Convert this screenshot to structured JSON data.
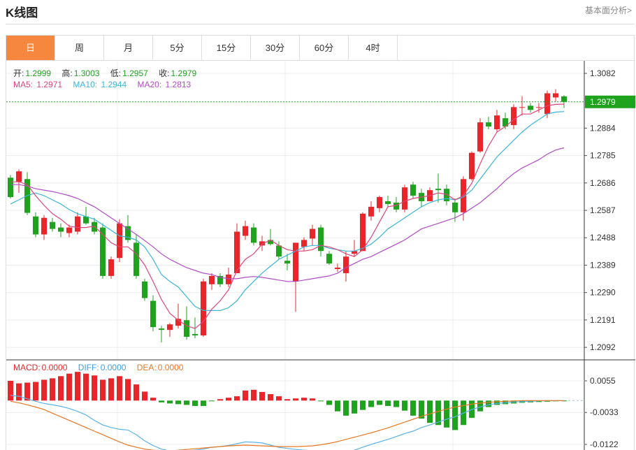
{
  "header": {
    "title": "K线图",
    "more_link": "基本面分析>"
  },
  "tabs": [
    {
      "label": "日",
      "active": true
    },
    {
      "label": "周"
    },
    {
      "label": "月"
    },
    {
      "label": "5分"
    },
    {
      "label": "15分"
    },
    {
      "label": "30分"
    },
    {
      "label": "60分"
    },
    {
      "label": "4时"
    }
  ],
  "ohlc_legend": {
    "open_label": "开:",
    "open": "1.2999",
    "high_label": "高:",
    "high": "1.3003",
    "low_label": "低:",
    "low": "1.2957",
    "close_label": "收:",
    "close": "1.2979"
  },
  "ma_legend": {
    "ma5_label": "MA5:",
    "ma5": "1.2971",
    "ma10_label": "MA10:",
    "ma10": "1.2944",
    "ma20_label": "MA20:",
    "ma20": "1.2813"
  },
  "macd_legend": {
    "macd_label": "MACD:",
    "macd": "0.0000",
    "diff_label": "DIFF:",
    "diff": "0.0000",
    "dea_label": "DEA:",
    "dea": "0.0000"
  },
  "price_axis_ticks": [
    "1.3082",
    "1.2884",
    "1.2785",
    "1.2686",
    "1.2587",
    "1.2488",
    "1.2389",
    "1.2290",
    "1.2191",
    "1.2092"
  ],
  "current_price_label": "1.2979",
  "macd_axis_ticks": [
    "0.0055",
    "-0.0033",
    "-0.0122"
  ],
  "colors": {
    "up": "#e8262a",
    "down": "#1fa31f",
    "ma5": "#e0457b",
    "ma10": "#38b6d8",
    "ma20": "#b04cc4",
    "dea": "#e87722",
    "diff": "#5bb2e8",
    "accent": "#f5873f"
  },
  "chart_data": {
    "type": "candlestick",
    "yrange": [
      1.2072,
      1.3082
    ],
    "candles": [
      [
        1.2705,
        1.2715,
        1.263,
        1.2635
      ],
      [
        1.269,
        1.2735,
        1.265,
        1.2728
      ],
      [
        1.27,
        1.2725,
        1.257,
        1.2578
      ],
      [
        1.2565,
        1.258,
        1.249,
        1.25
      ],
      [
        1.25,
        1.257,
        1.248,
        1.256
      ],
      [
        1.2545,
        1.256,
        1.251,
        1.252
      ],
      [
        1.2525,
        1.254,
        1.249,
        1.251
      ],
      [
        1.2505,
        1.2535,
        1.249,
        1.2525
      ],
      [
        1.251,
        1.258,
        1.25,
        1.2565
      ],
      [
        1.2565,
        1.26,
        1.2535,
        1.254
      ],
      [
        1.2545,
        1.256,
        1.25,
        1.251
      ],
      [
        1.2525,
        1.254,
        1.234,
        1.235
      ],
      [
        1.235,
        1.242,
        1.234,
        1.241
      ],
      [
        1.2415,
        1.2555,
        1.24,
        1.254
      ],
      [
        1.253,
        1.257,
        1.247,
        1.248
      ],
      [
        1.247,
        1.25,
        1.234,
        1.235
      ],
      [
        1.233,
        1.234,
        1.226,
        1.227
      ],
      [
        1.226,
        1.228,
        1.215,
        1.2165
      ],
      [
        1.216,
        1.217,
        1.211,
        1.2155
      ],
      [
        1.2155,
        1.218,
        1.213,
        1.2175
      ],
      [
        1.217,
        1.225,
        1.216,
        1.2195
      ],
      [
        1.219,
        1.224,
        1.212,
        1.213
      ],
      [
        1.214,
        1.22,
        1.2125,
        1.2135
      ],
      [
        1.2135,
        1.234,
        1.213,
        1.233
      ],
      [
        1.232,
        1.236,
        1.23,
        1.235
      ],
      [
        1.235,
        1.236,
        1.231,
        1.232
      ],
      [
        1.232,
        1.238,
        1.231,
        1.2355
      ],
      [
        1.236,
        1.254,
        1.236,
        1.251
      ],
      [
        1.2495,
        1.255,
        1.248,
        1.253
      ],
      [
        1.2525,
        1.254,
        1.246,
        1.247
      ],
      [
        1.246,
        1.2495,
        1.244,
        1.2475
      ],
      [
        1.248,
        1.252,
        1.246,
        1.2465
      ],
      [
        1.246,
        1.2475,
        1.241,
        1.242
      ],
      [
        1.2405,
        1.243,
        1.237,
        1.2395
      ],
      [
        1.233,
        1.247,
        1.222,
        1.247
      ],
      [
        1.2455,
        1.249,
        1.244,
        1.248
      ],
      [
        1.2485,
        1.2535,
        1.246,
        1.252
      ],
      [
        1.2525,
        1.2535,
        1.242,
        1.244
      ],
      [
        1.243,
        1.244,
        1.239,
        1.2395
      ],
      [
        1.2375,
        1.2395,
        1.2365,
        1.238
      ],
      [
        1.236,
        1.244,
        1.233,
        1.242
      ],
      [
        1.243,
        1.248,
        1.242,
        1.244
      ],
      [
        1.244,
        1.258,
        1.244,
        1.2575
      ],
      [
        1.2565,
        1.262,
        1.255,
        1.26
      ],
      [
        1.2595,
        1.264,
        1.258,
        1.2635
      ],
      [
        1.262,
        1.264,
        1.26,
        1.261
      ],
      [
        1.2615,
        1.2635,
        1.258,
        1.259
      ],
      [
        1.259,
        1.268,
        1.258,
        1.267
      ],
      [
        1.268,
        1.269,
        1.263,
        1.264
      ],
      [
        1.265,
        1.2665,
        1.26,
        1.262
      ],
      [
        1.262,
        1.267,
        1.262,
        1.266
      ],
      [
        1.2665,
        1.272,
        1.2615,
        1.266
      ],
      [
        1.2665,
        1.268,
        1.2605,
        1.262
      ],
      [
        1.2615,
        1.263,
        1.2545,
        1.258
      ],
      [
        1.258,
        1.271,
        1.255,
        1.27
      ],
      [
        1.27,
        1.28,
        1.2695,
        1.2795
      ],
      [
        1.28,
        1.292,
        1.2795,
        1.2905
      ],
      [
        1.2905,
        1.2925,
        1.288,
        1.289
      ],
      [
        1.288,
        1.295,
        1.287,
        1.293
      ],
      [
        1.292,
        1.294,
        1.288,
        1.289
      ],
      [
        1.2895,
        1.297,
        1.288,
        1.296
      ],
      [
        1.296,
        1.3,
        1.293,
        1.296
      ],
      [
        1.2965,
        1.2975,
        1.294,
        1.295
      ],
      [
        1.296,
        1.2975,
        1.294,
        1.296
      ],
      [
        1.2935,
        1.302,
        1.292,
        1.301
      ],
      [
        1.2995,
        1.3025,
        1.298,
        1.301
      ],
      [
        1.2999,
        1.3003,
        1.2957,
        1.2979
      ]
    ],
    "ma5": [
      1.269,
      1.269,
      1.268,
      1.264,
      1.2605,
      1.2575,
      1.2555,
      1.253,
      1.2525,
      1.2525,
      1.253,
      1.25,
      1.247,
      1.2455,
      1.2455,
      1.243,
      1.239,
      1.233,
      1.2265,
      1.2215,
      1.219,
      1.217,
      1.216,
      1.2185,
      1.223,
      1.226,
      1.23,
      1.237,
      1.241,
      1.243,
      1.2465,
      1.248,
      1.246,
      1.2445,
      1.244,
      1.244,
      1.2445,
      1.246,
      1.2455,
      1.2445,
      1.243,
      1.242,
      1.2445,
      1.249,
      1.2545,
      1.26,
      1.2605,
      1.262,
      1.263,
      1.2635,
      1.264,
      1.265,
      1.2645,
      1.2625,
      1.264,
      1.2685,
      1.2755,
      1.282,
      1.287,
      1.289,
      1.2915,
      1.2935,
      1.2935,
      1.295,
      1.2965,
      1.297,
      1.2971
    ],
    "ma10": [
      1.261,
      1.2625,
      1.264,
      1.265,
      1.264,
      1.2625,
      1.261,
      1.259,
      1.2575,
      1.2565,
      1.2555,
      1.2535,
      1.2515,
      1.2495,
      1.249,
      1.248,
      1.2455,
      1.241,
      1.2355,
      1.233,
      1.231,
      1.2275,
      1.224,
      1.2225,
      1.2225,
      1.2225,
      1.2235,
      1.226,
      1.23,
      1.233,
      1.236,
      1.2385,
      1.241,
      1.2425,
      1.244,
      1.2455,
      1.246,
      1.246,
      1.245,
      1.2445,
      1.244,
      1.244,
      1.245,
      1.2465,
      1.249,
      1.252,
      1.254,
      1.256,
      1.258,
      1.26,
      1.2615,
      1.2625,
      1.263,
      1.2625,
      1.2635,
      1.266,
      1.27,
      1.274,
      1.278,
      1.281,
      1.284,
      1.287,
      1.2895,
      1.2915,
      1.2935,
      1.2942,
      1.2944
    ],
    "ma20": [
      1.268,
      1.268,
      1.2675,
      1.2665,
      1.266,
      1.2655,
      1.2648,
      1.264,
      1.263,
      1.2615,
      1.26,
      1.258,
      1.256,
      1.254,
      1.252,
      1.25,
      1.2478,
      1.2455,
      1.243,
      1.241,
      1.2395,
      1.238,
      1.237,
      1.236,
      1.2355,
      1.2345,
      1.234,
      1.234,
      1.2345,
      1.2348,
      1.2345,
      1.234,
      1.2335,
      1.233,
      1.233,
      1.2335,
      1.234,
      1.2345,
      1.235,
      1.236,
      1.238,
      1.2395,
      1.241,
      1.242,
      1.2435,
      1.245,
      1.2465,
      1.248,
      1.25,
      1.252,
      1.253,
      1.254,
      1.255,
      1.256,
      1.2575,
      1.2595,
      1.2615,
      1.264,
      1.2665,
      1.2695,
      1.272,
      1.274,
      1.2755,
      1.277,
      1.279,
      1.2805,
      1.2813
    ],
    "macd": {
      "yrange": [
        -0.0122,
        0.009
      ],
      "hist": [
        0.0055,
        0.0048,
        0.005,
        0.0052,
        0.0058,
        0.0062,
        0.0068,
        0.0075,
        0.008,
        0.0075,
        0.007,
        0.0058,
        0.0062,
        0.0068,
        0.006,
        0.0045,
        0.0025,
        0.0008,
        -0.0005,
        -0.0008,
        -0.001,
        -0.0012,
        -0.0015,
        -0.0015,
        -0.0002,
        0.0004,
        0.0008,
        0.0012,
        0.0028,
        0.003,
        0.0024,
        0.0018,
        0.0012,
        0.0004,
        0.0006,
        0.0008,
        0.0006,
        -0.0002,
        -0.0012,
        -0.003,
        -0.0042,
        -0.0036,
        -0.0026,
        -0.0018,
        -0.0012,
        -0.0015,
        -0.0018,
        -0.0028,
        -0.0042,
        -0.005,
        -0.0062,
        -0.0068,
        -0.0075,
        -0.0082,
        -0.0068,
        -0.0048,
        -0.003,
        -0.0018,
        -0.0012,
        -0.001,
        -0.0008,
        -0.0006,
        -0.0005,
        -0.0004,
        -0.0003,
        -0.0002,
        -0.0001
      ],
      "diff": [
        0.0015,
        0.0012,
        0.0005,
        -0.0002,
        -0.0008,
        -0.0012,
        -0.0016,
        -0.0022,
        -0.003,
        -0.004,
        -0.0055,
        -0.0068,
        -0.0075,
        -0.008,
        -0.0082,
        -0.0095,
        -0.0112,
        -0.0125,
        -0.0135,
        -0.014,
        -0.0142,
        -0.014,
        -0.0138,
        -0.0135,
        -0.013,
        -0.0128,
        -0.0125,
        -0.012,
        -0.0115,
        -0.0116,
        -0.0118,
        -0.0124,
        -0.013,
        -0.0133,
        -0.0136,
        -0.0138,
        -0.014,
        -0.0142,
        -0.0145,
        -0.0147,
        -0.0145,
        -0.0138,
        -0.013,
        -0.0122,
        -0.0115,
        -0.0108,
        -0.01,
        -0.0092,
        -0.0085,
        -0.0075,
        -0.0068,
        -0.006,
        -0.0052,
        -0.0045,
        -0.0035,
        -0.0025,
        -0.0018,
        -0.0012,
        -0.0008,
        -0.0006,
        -0.0004,
        -0.0003,
        -0.0002,
        -0.0001,
        0.0,
        0.0,
        0.0
      ],
      "dea": [
        -0.0002,
        -0.0006,
        -0.0012,
        -0.0018,
        -0.0025,
        -0.0035,
        -0.0045,
        -0.0055,
        -0.0065,
        -0.0075,
        -0.0085,
        -0.0095,
        -0.0105,
        -0.0115,
        -0.0124,
        -0.013,
        -0.0135,
        -0.0138,
        -0.014,
        -0.014,
        -0.0138,
        -0.0136,
        -0.0134,
        -0.0132,
        -0.013,
        -0.0128,
        -0.0126,
        -0.0125,
        -0.0124,
        -0.0125,
        -0.0126,
        -0.0127,
        -0.0128,
        -0.0128,
        -0.0128,
        -0.0127,
        -0.0126,
        -0.0123,
        -0.0119,
        -0.0114,
        -0.0108,
        -0.0102,
        -0.0096,
        -0.009,
        -0.0083,
        -0.0076,
        -0.0068,
        -0.006,
        -0.0052,
        -0.0044,
        -0.0037,
        -0.003,
        -0.0024,
        -0.0018,
        -0.0014,
        -0.001,
        -0.0007,
        -0.0005,
        -0.0003,
        -0.0002,
        -0.0001,
        0.0,
        0.0,
        0.0,
        0.0,
        0.0,
        0.0
      ]
    }
  }
}
